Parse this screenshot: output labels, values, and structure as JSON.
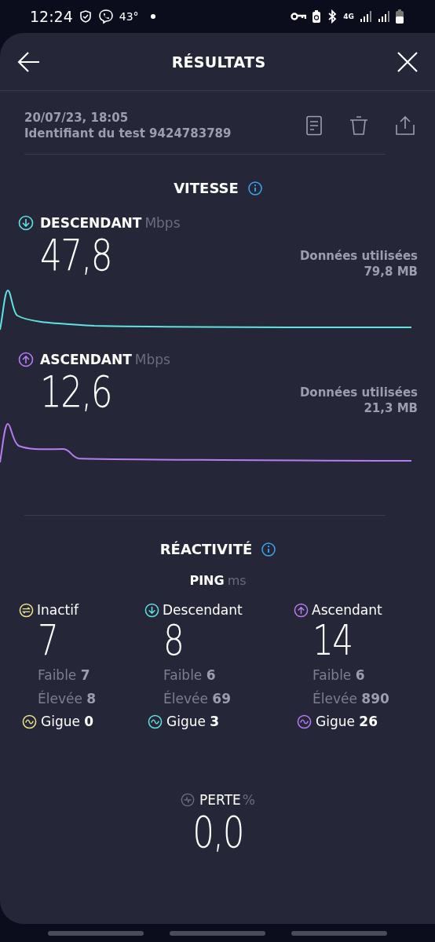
{
  "status_bar": {
    "time": "12:24",
    "temperature": "43°",
    "network": "4G"
  },
  "header": {
    "title": "RÉSULTATS"
  },
  "test": {
    "date": "20/07/23, 18:05",
    "id": "Identifiant du test 9424783789"
  },
  "speed": {
    "title": "VITESSE",
    "items": [
      {
        "kind": "download",
        "label": "DESCENDANT",
        "unit": "Mbps",
        "value": "47,8",
        "data_label": "Données utilisées",
        "data_value": "79,8 MB"
      },
      {
        "kind": "upload",
        "label": "ASCENDANT",
        "unit": "Mbps",
        "value": "12,6",
        "data_label": "Données utilisées",
        "data_value": "21,3 MB"
      }
    ]
  },
  "responsiveness": {
    "title": "RÉACTIVITÉ",
    "ping_label": "PING",
    "ping_unit": "ms",
    "columns": [
      {
        "kind": "idle",
        "label": "Inactif",
        "value": "7",
        "low": "Faible **7**",
        "high": "Élevée **8**",
        "jitter": "Gigue **0**"
      },
      {
        "kind": "download",
        "label": "Descendant",
        "value": "8",
        "low": "Faible **6**",
        "high": "Élevée **69**",
        "jitter": "Gigue **3**"
      },
      {
        "kind": "upload",
        "label": "Ascendant",
        "value": "14",
        "low": "Faible **6**",
        "high": "Élevée **890**",
        "jitter": "Gigue **26**"
      }
    ]
  },
  "loss": {
    "label": "PERTE",
    "unit": "%",
    "value": "0,0"
  }
}
